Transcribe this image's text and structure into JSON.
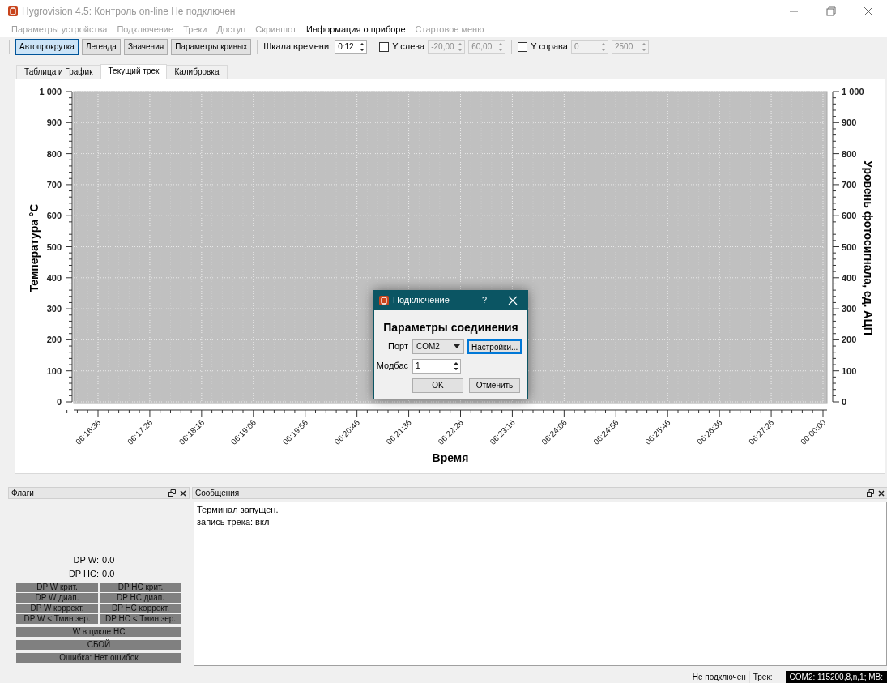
{
  "window": {
    "title": "Hygrovision 4.5: Контроль on-line Не подключен"
  },
  "menu": [
    {
      "label": "Параметры устройства",
      "disabled": true
    },
    {
      "label": "Подключение",
      "disabled": true
    },
    {
      "label": "Треки",
      "disabled": true
    },
    {
      "label": "Доступ",
      "disabled": true
    },
    {
      "label": "Скриншот",
      "disabled": true
    },
    {
      "label": "Информация о приборе",
      "disabled": false
    },
    {
      "label": "Стартовое меню",
      "disabled": true
    }
  ],
  "toolbar": {
    "buttons": [
      {
        "label": "Автопрокрутка",
        "checked": true
      },
      {
        "label": "Легенда",
        "checked": false
      },
      {
        "label": "Значения",
        "checked": false
      },
      {
        "label": "Параметры кривых",
        "checked": false
      }
    ],
    "time_scale": {
      "label": "Шкала времени:",
      "value": "0:12"
    },
    "y_left": {
      "label": "Y слева",
      "checked": false,
      "min": "-20,00",
      "max": "60,00"
    },
    "y_right": {
      "label": "Y справа",
      "checked": false,
      "min": "0",
      "max": "2500"
    }
  },
  "tabs": [
    {
      "label": "Таблица и График",
      "selected": false
    },
    {
      "label": "Текущий трек",
      "selected": true
    },
    {
      "label": "Калибровка",
      "selected": false
    }
  ],
  "chart": {
    "y_left_title": "Температура °C",
    "y_right_title": "Уровень фотосигнала, ед. АЦП",
    "x_title": "Время",
    "y_left_ticks": [
      "1 000",
      "900",
      "800",
      "700",
      "600",
      "500",
      "400",
      "300",
      "200",
      "100",
      "0"
    ],
    "y_right_ticks": [
      "1 000",
      "900",
      "800",
      "700",
      "600",
      "500",
      "400",
      "300",
      "200",
      "100",
      "0"
    ],
    "x_ticks": [
      "06:16:36",
      "06:17:26",
      "06:18:16",
      "06:19:06",
      "06:19:56",
      "06:20:46",
      "06:21:36",
      "06:22:26",
      "06:23:16",
      "06:24:06",
      "06:24:56",
      "06:25:46",
      "06:26:36",
      "06:27:26",
      "00:00:00"
    ]
  },
  "dialog": {
    "title": "Подключение",
    "help": "?",
    "heading": "Параметры соединения",
    "port_label": "Порт",
    "port_value": "COM2",
    "settings_button": "Настройки...",
    "modbus_label": "Модбас",
    "modbus_value": "1",
    "ok_button": "OK",
    "cancel_button": "Отменить"
  },
  "flags_dock": {
    "title": "Флаги",
    "readings": [
      {
        "label": "DP W:",
        "value": "0.0"
      },
      {
        "label": "DP HC:",
        "value": "0.0"
      }
    ],
    "grid": [
      "DP W крит.",
      "DP HC крит.",
      "DP W диап.",
      "DP HC диап.",
      "DP W коррект.",
      "DP HC коррект.",
      "DP W < Тмин зер.",
      "DP HC < Тмин зер."
    ],
    "bars": [
      "W в цикле HC",
      "СБОЙ",
      "Ошибка: Нет ошибок"
    ]
  },
  "messages_dock": {
    "title": "Сообщения",
    "lines": [
      "Терминал запущен.",
      "запись трека: вкл"
    ]
  },
  "status_bar": {
    "connection": "Не подключен",
    "track": "Трек:",
    "port_info": "COM2: 115200,8,n,1; MB:"
  }
}
